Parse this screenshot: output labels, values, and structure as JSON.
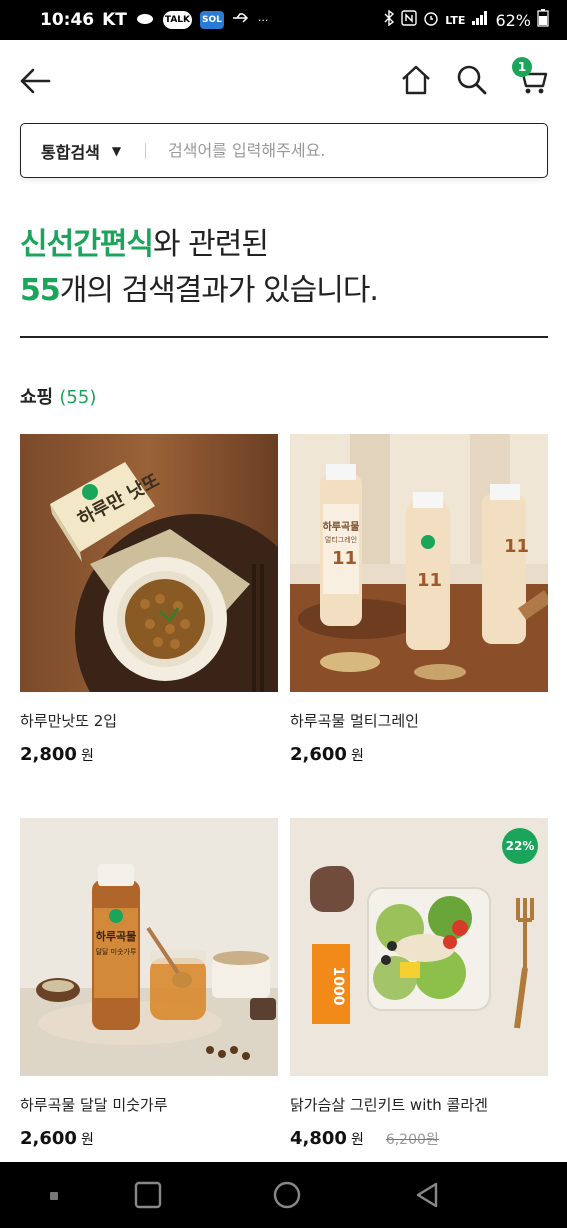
{
  "status_bar": {
    "time": "10:46",
    "carrier": "KT",
    "talk_badge": "TALK",
    "sol_badge": "SOL",
    "more": "···",
    "network": "LTE",
    "battery": "62%"
  },
  "header": {
    "cart_count": "1"
  },
  "search": {
    "scope_label": "통합검색",
    "placeholder": "검색어를 입력해주세요."
  },
  "result": {
    "keyword": "신선간편식",
    "line1_suffix": "와 관련된",
    "count": "55",
    "line2_suffix": "개의 검색결과가 있습니다."
  },
  "section": {
    "title": "쇼핑",
    "count": "(55)"
  },
  "products": [
    {
      "name": "하루만낫또 2입",
      "price": "2,800",
      "currency": "원",
      "original_price": "",
      "discount": ""
    },
    {
      "name": "하루곡물 멀티그레인",
      "price": "2,600",
      "currency": "원",
      "original_price": "",
      "discount": ""
    },
    {
      "name": "하루곡물 달달 미숫가루",
      "price": "2,600",
      "currency": "원",
      "original_price": "",
      "discount": ""
    },
    {
      "name": "닭가슴살 그린키트 with 콜라겐",
      "price": "4,800",
      "currency": "원",
      "original_price": "6,200원",
      "discount": "22%"
    }
  ],
  "product_image_text": {
    "natto_box": "하루만 낫또",
    "grain_label": "하루곡물",
    "grain_sub": "멀티그레인",
    "misu_label": "하루곡물",
    "misu_sub": "달달 미숫가루",
    "collagen": "1000"
  },
  "colors": {
    "accent": "#1aa55a",
    "text": "#222222",
    "strike": "#e44444"
  }
}
